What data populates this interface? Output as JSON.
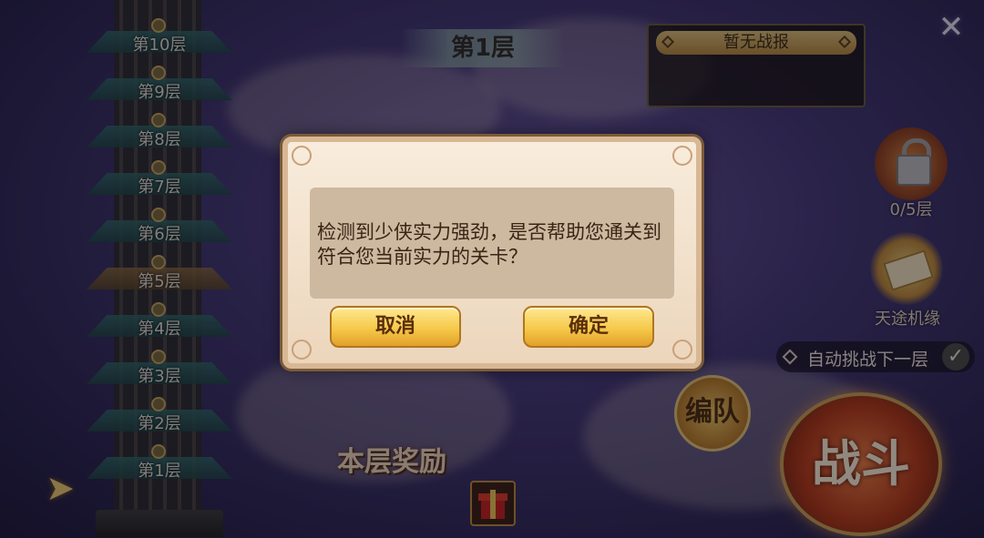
{
  "tower": {
    "floors": [
      "第10层",
      "第9层",
      "第8层",
      "第7层",
      "第6层",
      "第5层",
      "第4层",
      "第3层",
      "第2层",
      "第1层"
    ]
  },
  "header": {
    "current_floor": "第1层",
    "report_title": "暂无战报"
  },
  "side": {
    "progress_label": "0/5层",
    "fortune_label": "天途机缘",
    "auto_next_label": "自动挑战下一层"
  },
  "actions": {
    "team_label": "编队",
    "battle_label": "战斗"
  },
  "reward": {
    "title": "本层奖励"
  },
  "dialog": {
    "message": "检测到少侠实力强劲，是否帮助您通关到\n符合您当前实力的关卡？",
    "cancel_label": "取消",
    "confirm_label": "确定"
  },
  "icons": {
    "close": "close-icon",
    "arrow": "arrow-right-icon",
    "lock": "lock-icon",
    "scroll": "scroll-icon",
    "gift": "gift-icon",
    "check": "check-icon"
  },
  "colors": {
    "button_gold": "#f6c94a",
    "dialog_bg": "#f3e2cc",
    "message_bg": "#cdb8a0"
  }
}
